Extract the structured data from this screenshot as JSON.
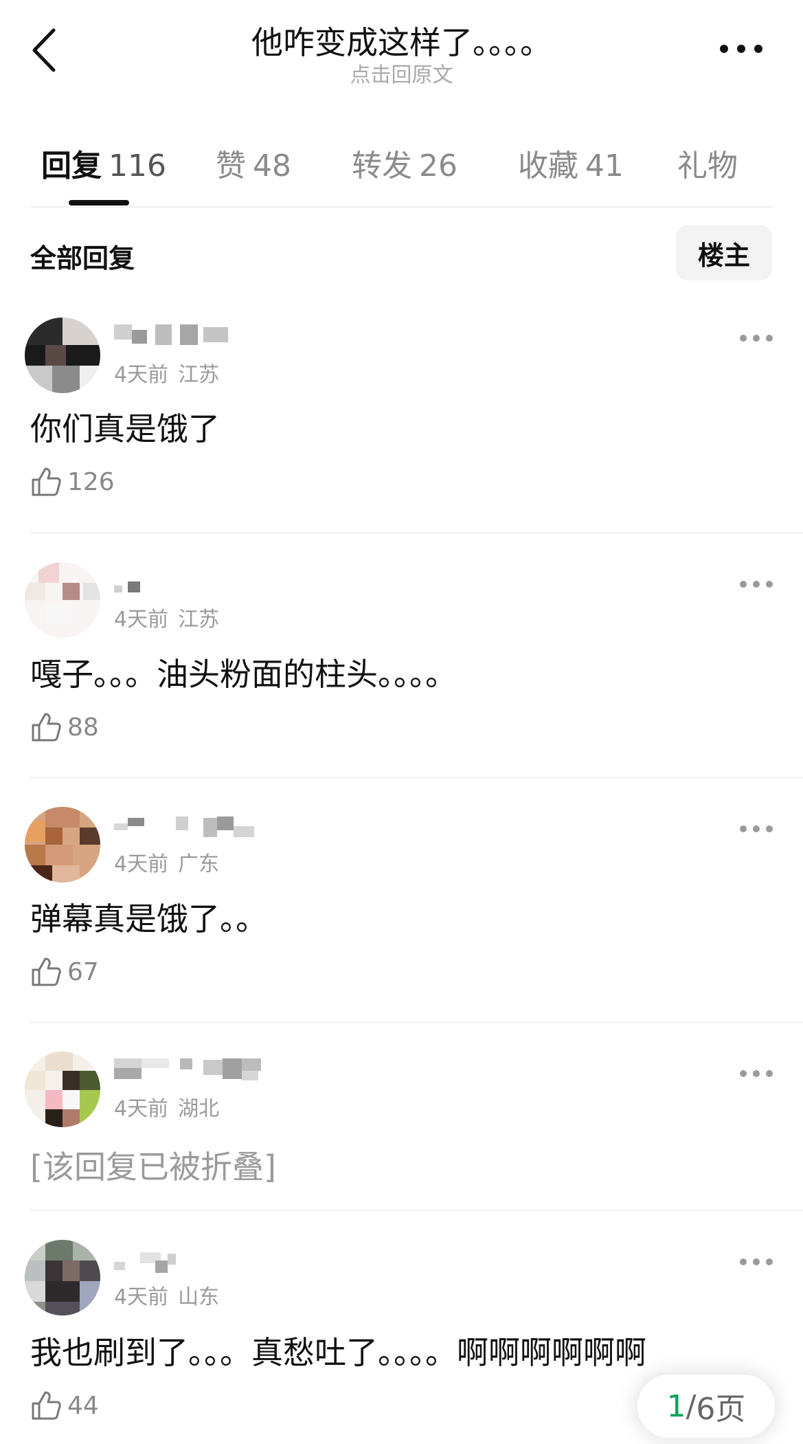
{
  "header": {
    "title": "他咋变成这样了。。。。",
    "subtitle": "点击回原文"
  },
  "tabs": [
    {
      "label": "回复",
      "count": "116"
    },
    {
      "label": "赞",
      "count": "48"
    },
    {
      "label": "转发",
      "count": "26"
    },
    {
      "label": "收藏",
      "count": "41"
    },
    {
      "label": "礼物",
      "count": ""
    }
  ],
  "filter": {
    "all_label": "全部回复",
    "op_button": "楼主"
  },
  "comments": [
    {
      "time": "4天前",
      "location": "江苏",
      "text": "你们真是饿了",
      "likes": "126"
    },
    {
      "time": "4天前",
      "location": "江苏",
      "text": "嘎子。。。油头粉面的柱头。。。。",
      "likes": "88"
    },
    {
      "time": "4天前",
      "location": "广东",
      "text": "弹幕真是饿了。。",
      "likes": "67"
    },
    {
      "time": "4天前",
      "location": "湖北",
      "text": "[该回复已被折叠]",
      "likes": ""
    },
    {
      "time": "4天前",
      "location": "山东",
      "text": "我也刷到了。。。真愁吐了。。。。啊啊啊啊啊啊",
      "likes": "44"
    }
  ],
  "pager": {
    "current": "1",
    "sep": "/",
    "total": "6页"
  },
  "colors": {
    "accent_green": "#07a35a",
    "muted_text": "#9a9a9a",
    "op_bg": "#f3f3f3"
  }
}
